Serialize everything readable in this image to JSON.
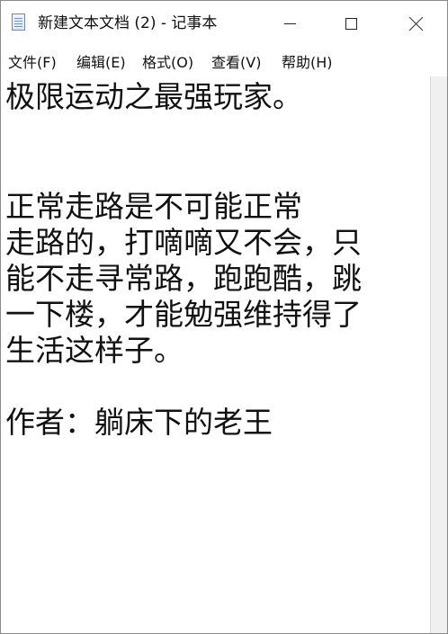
{
  "window": {
    "title": "新建文本文档 (2) - 记事本"
  },
  "menu": {
    "file": "文件(F)",
    "edit": "编辑(E)",
    "format": "格式(O)",
    "view": "查看(V)",
    "help": "帮助(H)"
  },
  "editor": {
    "lines": [
      "极限运动之最强玩家。",
      "",
      "",
      "    正常走路是不可能正常",
      "走路的，打嘀嘀又不会，只",
      "能不走寻常路，跑跑酷，跳",
      "一下楼，才能勉强维持得了",
      "生活这样子。",
      "",
      "作者：躺床下的老王"
    ]
  },
  "icons": {
    "app": "notepad-icon",
    "minimize": "minimize-icon",
    "maximize": "maximize-icon",
    "close": "close-icon"
  }
}
